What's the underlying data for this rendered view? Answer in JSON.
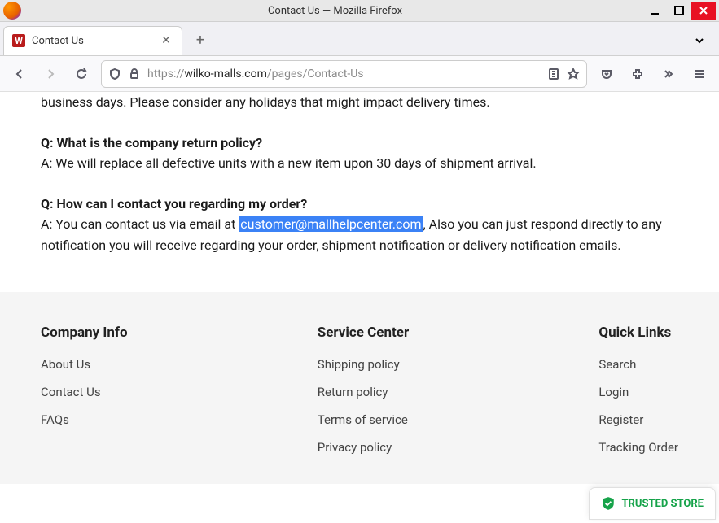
{
  "window": {
    "title": "Contact Us — Mozilla Firefox"
  },
  "tab": {
    "favicon_letter": "W",
    "title": "Contact Us"
  },
  "url": {
    "scheme": "https://",
    "domain": "wilko-malls.com",
    "path": "/pages/Contact-Us"
  },
  "content": {
    "p0": "business days.  Please consider any holidays that might impact delivery times.",
    "q1": "Q: What is the company return policy?",
    "a1": "A: We will replace all defective units with a new item upon 30 days of shipment arrival.",
    "q2": "Q: How can I contact you regarding my order?",
    "a2_pre": "A: You can contact us via email at ",
    "a2_email": "customer@mallhelpcenter.com",
    "a2_post": ", Also you can just respond directly to any notification you will receive regarding your order, shipment notification or delivery notification emails."
  },
  "footer": {
    "col1": {
      "title": "Company Info",
      "links": [
        "About Us",
        "Contact Us",
        "FAQs"
      ]
    },
    "col2": {
      "title": "Service Center",
      "links": [
        "Shipping policy",
        "Return policy",
        "Terms of service",
        "Privacy policy"
      ]
    },
    "col3": {
      "title": "Quick Links",
      "links": [
        "Search",
        "Login",
        "Register",
        "Tracking Order"
      ]
    }
  },
  "badge": {
    "label": "TRUSTED STORE"
  }
}
